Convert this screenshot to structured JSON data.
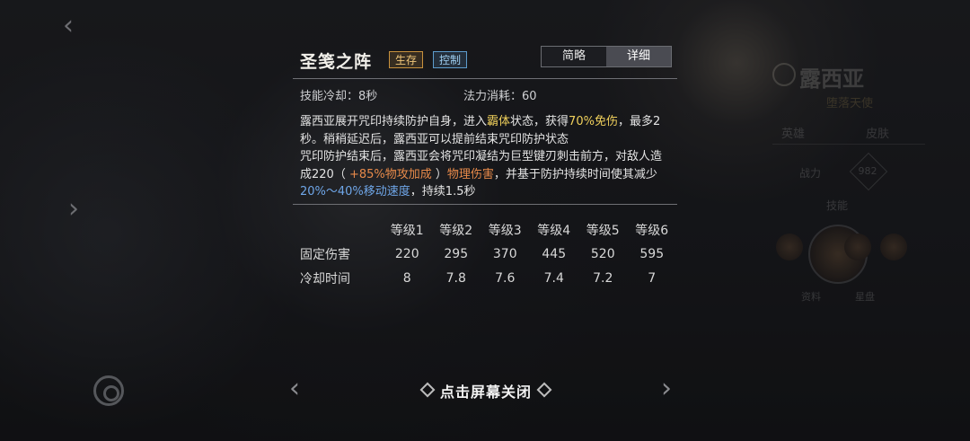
{
  "skill": {
    "name": "圣笺之阵",
    "tags": [
      "生存",
      "控制"
    ],
    "view_toggle": {
      "brief": "简略",
      "detail": "详细",
      "selected": "详细"
    },
    "cooldown_label": "技能冷却：8秒",
    "mana_label": "法力消耗：60",
    "description": [
      [
        {
          "t": "露西亚展开咒印持续防护自身，进入"
        },
        {
          "t": "霸体",
          "c": "y"
        },
        {
          "t": "状态，获得"
        },
        {
          "t": "70%免伤",
          "c": "y"
        },
        {
          "t": "，最多2秒。稍稍延迟后，露西亚可以提前结束咒印防护状态"
        }
      ],
      [
        {
          "t": "咒印防护结束后，露西亚会将咒印凝结为巨型键刃刺击前方，对敌人造成220（ "
        },
        {
          "t": "+85%物攻加成",
          "c": "o"
        },
        {
          "t": " ）"
        },
        {
          "t": "物理伤害",
          "c": "o"
        },
        {
          "t": "，并基于防护持续时间使其减少"
        },
        {
          "t": "20%～40%移动速度",
          "c": "b"
        },
        {
          "t": "，持续1.5秒"
        }
      ]
    ],
    "levels": {
      "headers": [
        "等级1",
        "等级2",
        "等级3",
        "等级4",
        "等级5",
        "等级6"
      ],
      "rows": [
        {
          "label": "固定伤害",
          "values": [
            "220",
            "295",
            "370",
            "445",
            "520",
            "595"
          ]
        },
        {
          "label": "冷却时间",
          "values": [
            "8",
            "7.8",
            "7.6",
            "7.4",
            "7.2",
            "7"
          ]
        }
      ]
    }
  },
  "close_hint": "点击屏幕关闭",
  "background": {
    "hero_name": "露西亚",
    "hero_title": "堕落天使",
    "tabs": [
      "英雄",
      "皮肤"
    ],
    "power_label": "战力",
    "power_value": "982",
    "skill_label": "技能",
    "footer": [
      "资料",
      "星盘"
    ]
  },
  "colors": {
    "highlight_yellow": "#f0d05c",
    "highlight_orange": "#e88a4a",
    "highlight_blue": "#6fa6e8",
    "tag_survive": "#c7913d",
    "tag_control": "#5d9ccc"
  }
}
